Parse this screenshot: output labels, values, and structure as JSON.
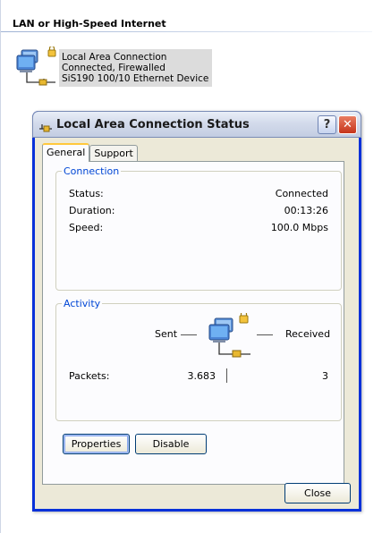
{
  "section": {
    "title": "LAN or High-Speed Internet"
  },
  "connection_item": {
    "name": "Local Area Connection",
    "status": "Connected, Firewalled",
    "device": "SiS190 100/10 Ethernet Device"
  },
  "dialog": {
    "title": "Local Area Connection Status",
    "help_label": "?",
    "close_glyph": "✕",
    "tabs": [
      {
        "label": "General",
        "active": true
      },
      {
        "label": "Support",
        "active": false
      }
    ],
    "connection_group": {
      "legend": "Connection",
      "rows": [
        {
          "label": "Status:",
          "value": "Connected"
        },
        {
          "label": "Duration:",
          "value": "00:13:26"
        },
        {
          "label": "Speed:",
          "value": "100.0 Mbps"
        }
      ]
    },
    "activity_group": {
      "legend": "Activity",
      "sent_label": "Sent",
      "received_label": "Received",
      "packets_label": "Packets:",
      "packets_sent": "3.683",
      "packets_received": "3"
    },
    "buttons": {
      "properties": "Properties",
      "disable": "Disable",
      "close": "Close"
    }
  }
}
